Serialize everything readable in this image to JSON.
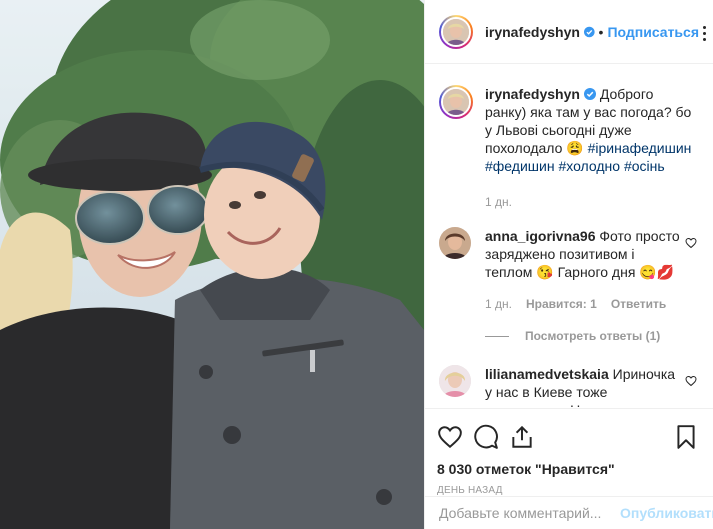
{
  "post": {
    "username": "irynafedyshyn",
    "follow_label": "Подписаться",
    "separator": "•"
  },
  "caption": {
    "username": "irynafedyshyn",
    "text": "Доброго ранку) яка там у вас погода? бо у Львові сьогодні дуже похолодало 😩",
    "hashtags": [
      "#іринафедишин",
      "#федишин",
      "#холодно",
      "#осінь"
    ],
    "time": "1 дн."
  },
  "comments": [
    {
      "username": "anna_igorivna96",
      "text": "Фото просто заряджено позитивом і теплом 😘 Гарного дня 😋💋",
      "time": "1 дн.",
      "likes": "Нравится: 1",
      "reply": "Ответить",
      "view_replies": "Посмотреть ответы (1)"
    },
    {
      "username": "lilianamedvetskaia",
      "text": "Ириночка у нас в Киеве тоже похолодало. Но это не повод для плохого настроения. В душе всегда лето. Желаю вам хорошего дня и"
    }
  ],
  "actions": {
    "likes": "8 030 отметок \"Нравится\"",
    "date": "день назад"
  },
  "add_comment": {
    "placeholder": "Добавьте комментарий...",
    "publish": "Опубликовать"
  },
  "icons": [
    "verified-badge-icon",
    "more-options-icon",
    "heart-icon",
    "comment-icon",
    "share-icon",
    "bookmark-icon"
  ],
  "colors": {
    "link": "#3897f0",
    "hashtag": "#003569",
    "muted": "#999999",
    "publish_disabled": "#b2dffc"
  }
}
